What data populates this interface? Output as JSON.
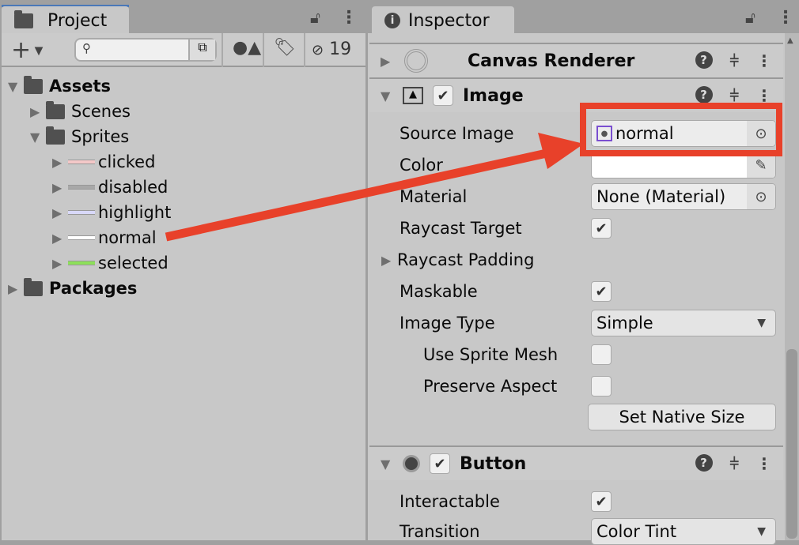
{
  "project": {
    "tab": "Project",
    "search_placeholder": "",
    "hidden_count": "19",
    "tree": [
      {
        "label": "Assets",
        "bold": true,
        "expanded": true
      },
      {
        "label": "Scenes"
      },
      {
        "label": "Sprites",
        "expanded": true
      },
      {
        "label": "clicked",
        "swatch": "#f4c8c8"
      },
      {
        "label": "disabled",
        "swatch": "#a8a8a8"
      },
      {
        "label": "highlight",
        "swatch": "#d8d8f8"
      },
      {
        "label": "normal",
        "swatch": "#ffffff"
      },
      {
        "label": "selected",
        "swatch": "#8de05a"
      },
      {
        "label": "Packages",
        "bold": true
      }
    ]
  },
  "inspector": {
    "tab": "Inspector",
    "components": {
      "canvas_renderer": "Canvas Renderer",
      "image": "Image",
      "button": "Button"
    },
    "image_props": {
      "source_image_label": "Source Image",
      "source_image_value": "normal",
      "color_label": "Color",
      "color_value": "#ffffff",
      "material_label": "Material",
      "material_value": "None (Material)",
      "raycast_target_label": "Raycast Target",
      "raycast_target": true,
      "raycast_padding_label": "Raycast Padding",
      "maskable_label": "Maskable",
      "maskable": true,
      "image_type_label": "Image Type",
      "image_type_value": "Simple",
      "use_sprite_mesh_label": "Use Sprite Mesh",
      "use_sprite_mesh": false,
      "preserve_aspect_label": "Preserve Aspect",
      "preserve_aspect": false,
      "set_native_size": "Set Native Size"
    },
    "button_props": {
      "interactable_label": "Interactable",
      "interactable": true,
      "transition_label": "Transition",
      "transition_value": "Color Tint"
    }
  },
  "annotation_color": "#e8412a"
}
